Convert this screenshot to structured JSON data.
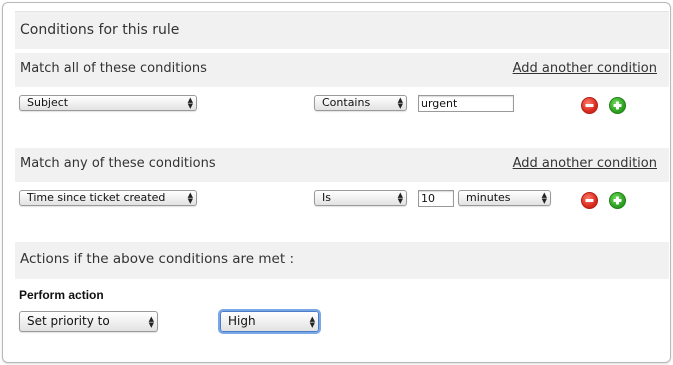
{
  "panel": {
    "title": "Conditions for this rule"
  },
  "match_all": {
    "label": "Match all of these conditions",
    "add_link": "Add another condition",
    "row": {
      "field": "Subject",
      "operator": "Contains",
      "value": "urgent"
    }
  },
  "match_any": {
    "label": "Match any of these conditions",
    "add_link": "Add another condition",
    "row": {
      "field": "Time since ticket created",
      "operator": "Is",
      "value": "10",
      "unit": "minutes"
    }
  },
  "actions": {
    "header": "Actions if the above conditions are met :",
    "perform_label": "Perform action",
    "action": "Set priority to",
    "priority": "High"
  },
  "colors": {
    "remove": "#d5271b",
    "add": "#2b9d1f",
    "band": "#f1f1f1"
  }
}
